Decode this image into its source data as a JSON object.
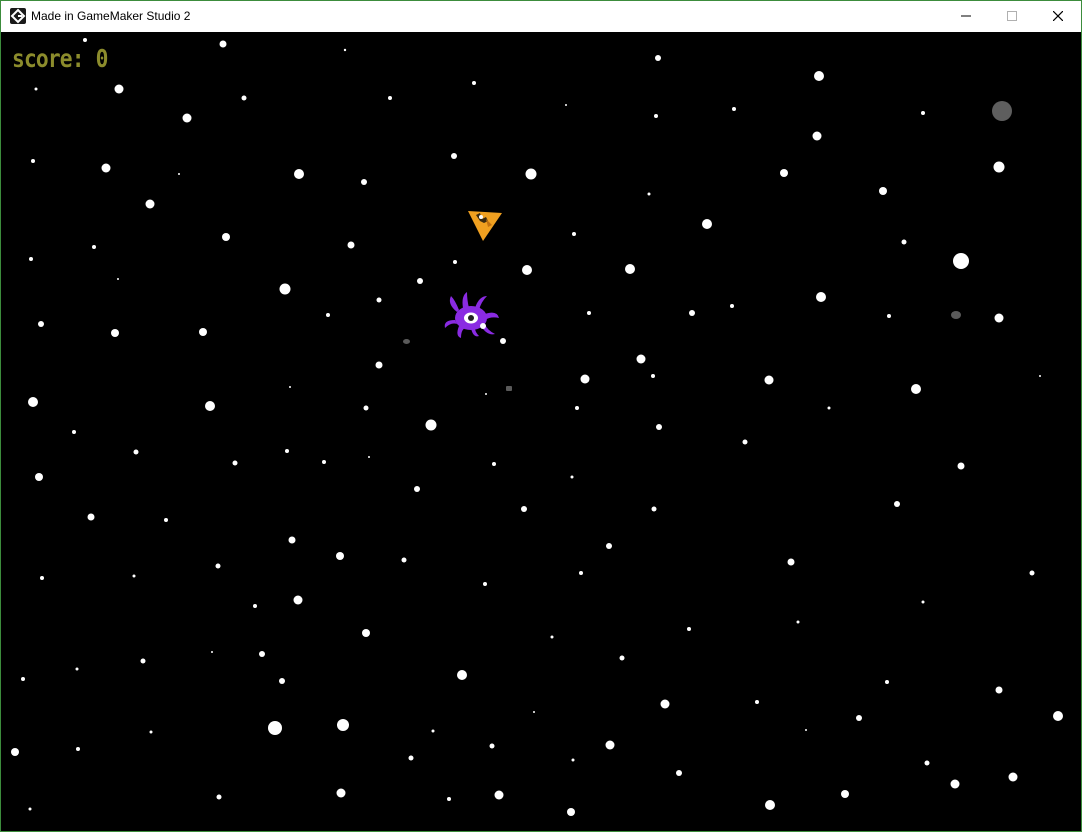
{
  "window": {
    "title": "Made in GameMaker Studio 2",
    "icon": "gamemaker-icon",
    "controls": [
      "minimize-icon",
      "maximize-icon",
      "close-icon"
    ]
  },
  "hud": {
    "score_label": "score:",
    "score_value": "0",
    "score_color": "#8c8c2c"
  },
  "sprites": {
    "player": "orange-spaceship",
    "enemy": "purple-one-eyed-monster",
    "player_color": "#f0a020",
    "enemy_color": "#8a2be2"
  },
  "background_color": "#000000",
  "star_color": "#ffffff"
}
